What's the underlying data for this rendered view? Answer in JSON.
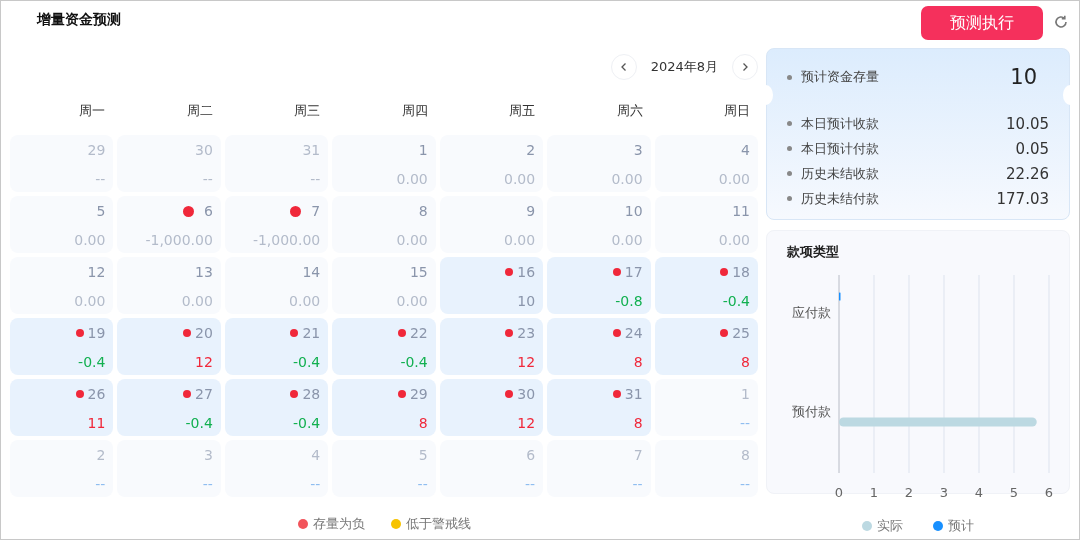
{
  "title": "增量资金预测",
  "execute_button": "预测执行",
  "calendar": {
    "month": "2024年8月",
    "weekdays": [
      "周一",
      "周二",
      "周三",
      "周四",
      "周五",
      "周六",
      "周日"
    ],
    "weeks": [
      [
        {
          "day": "29",
          "value": "--",
          "in_month": false,
          "forecast": false,
          "flagged": false,
          "color": "#b3bbca"
        },
        {
          "day": "30",
          "value": "--",
          "in_month": false,
          "forecast": false,
          "flagged": false,
          "color": "#b3bbca"
        },
        {
          "day": "31",
          "value": "--",
          "in_month": false,
          "forecast": false,
          "flagged": false,
          "color": "#b3bbca"
        },
        {
          "day": "1",
          "value": "0.00",
          "in_month": true,
          "forecast": false,
          "flagged": false,
          "color": "#b3bbca"
        },
        {
          "day": "2",
          "value": "0.00",
          "in_month": true,
          "forecast": false,
          "flagged": false,
          "color": "#b3bbca"
        },
        {
          "day": "3",
          "value": "0.00",
          "in_month": true,
          "forecast": false,
          "flagged": false,
          "color": "#b3bbca"
        },
        {
          "day": "4",
          "value": "0.00",
          "in_month": true,
          "forecast": false,
          "flagged": false,
          "color": "#b3bbca"
        }
      ],
      [
        {
          "day": "5",
          "value": "0.00",
          "in_month": true,
          "forecast": false,
          "flagged": false,
          "color": "#b3bbca"
        },
        {
          "day": "6",
          "value": "-1,000.00",
          "in_month": true,
          "forecast": false,
          "flagged": true,
          "color": "#b3bbca"
        },
        {
          "day": "7",
          "value": "-1,000.00",
          "in_month": true,
          "forecast": false,
          "flagged": true,
          "color": "#b3bbca"
        },
        {
          "day": "8",
          "value": "0.00",
          "in_month": true,
          "forecast": false,
          "flagged": false,
          "color": "#b3bbca"
        },
        {
          "day": "9",
          "value": "0.00",
          "in_month": true,
          "forecast": false,
          "flagged": false,
          "color": "#b3bbca"
        },
        {
          "day": "10",
          "value": "0.00",
          "in_month": true,
          "forecast": false,
          "flagged": false,
          "color": "#b3bbca"
        },
        {
          "day": "11",
          "value": "0.00",
          "in_month": true,
          "forecast": false,
          "flagged": false,
          "color": "#b3bbca"
        }
      ],
      [
        {
          "day": "12",
          "value": "0.00",
          "in_month": true,
          "forecast": false,
          "flagged": false,
          "color": "#b3bbca"
        },
        {
          "day": "13",
          "value": "0.00",
          "in_month": true,
          "forecast": false,
          "flagged": false,
          "color": "#b3bbca"
        },
        {
          "day": "14",
          "value": "0.00",
          "in_month": true,
          "forecast": false,
          "flagged": false,
          "color": "#b3bbca"
        },
        {
          "day": "15",
          "value": "0.00",
          "in_month": true,
          "forecast": false,
          "flagged": false,
          "color": "#b3bbca"
        },
        {
          "day": "16",
          "value": "10",
          "in_month": true,
          "forecast": true,
          "flagged": true,
          "color": "#8a95ab"
        },
        {
          "day": "17",
          "value": "-0.8",
          "in_month": true,
          "forecast": true,
          "flagged": true,
          "color": "#12b050"
        },
        {
          "day": "18",
          "value": "-0.4",
          "in_month": true,
          "forecast": true,
          "flagged": true,
          "color": "#12b050"
        }
      ],
      [
        {
          "day": "19",
          "value": "-0.4",
          "in_month": true,
          "forecast": true,
          "flagged": true,
          "color": "#12b050"
        },
        {
          "day": "20",
          "value": "12",
          "in_month": true,
          "forecast": true,
          "flagged": true,
          "color": "#f0283a"
        },
        {
          "day": "21",
          "value": "-0.4",
          "in_month": true,
          "forecast": true,
          "flagged": true,
          "color": "#12b050"
        },
        {
          "day": "22",
          "value": "-0.4",
          "in_month": true,
          "forecast": true,
          "flagged": true,
          "color": "#12b050"
        },
        {
          "day": "23",
          "value": "12",
          "in_month": true,
          "forecast": true,
          "flagged": true,
          "color": "#f0283a"
        },
        {
          "day": "24",
          "value": "8",
          "in_month": true,
          "forecast": true,
          "flagged": true,
          "color": "#f0283a"
        },
        {
          "day": "25",
          "value": "8",
          "in_month": true,
          "forecast": true,
          "flagged": true,
          "color": "#f0283a"
        }
      ],
      [
        {
          "day": "26",
          "value": "11",
          "in_month": true,
          "forecast": true,
          "flagged": true,
          "color": "#f0283a"
        },
        {
          "day": "27",
          "value": "-0.4",
          "in_month": true,
          "forecast": true,
          "flagged": true,
          "color": "#12b050"
        },
        {
          "day": "28",
          "value": "-0.4",
          "in_month": true,
          "forecast": true,
          "flagged": true,
          "color": "#12b050"
        },
        {
          "day": "29",
          "value": "8",
          "in_month": true,
          "forecast": true,
          "flagged": true,
          "color": "#f0283a"
        },
        {
          "day": "30",
          "value": "12",
          "in_month": true,
          "forecast": true,
          "flagged": true,
          "color": "#f0283a"
        },
        {
          "day": "31",
          "value": "8",
          "in_month": true,
          "forecast": true,
          "flagged": true,
          "color": "#f0283a"
        },
        {
          "day": "1",
          "value": "--",
          "in_month": false,
          "forecast": false,
          "flagged": false,
          "color": "#8fbdf0"
        }
      ],
      [
        {
          "day": "2",
          "value": "--",
          "in_month": false,
          "forecast": false,
          "flagged": false,
          "color": "#8fbdf0"
        },
        {
          "day": "3",
          "value": "--",
          "in_month": false,
          "forecast": false,
          "flagged": false,
          "color": "#8fbdf0"
        },
        {
          "day": "4",
          "value": "--",
          "in_month": false,
          "forecast": false,
          "flagged": false,
          "color": "#8fbdf0"
        },
        {
          "day": "5",
          "value": "--",
          "in_month": false,
          "forecast": false,
          "flagged": false,
          "color": "#8fbdf0"
        },
        {
          "day": "6",
          "value": "--",
          "in_month": false,
          "forecast": false,
          "flagged": false,
          "color": "#8fbdf0"
        },
        {
          "day": "7",
          "value": "--",
          "in_month": false,
          "forecast": false,
          "flagged": false,
          "color": "#8fbdf0"
        },
        {
          "day": "8",
          "value": "--",
          "in_month": false,
          "forecast": false,
          "flagged": false,
          "color": "#8fbdf0"
        }
      ]
    ],
    "legend": [
      {
        "label": "存量为负",
        "color": "#f2545b"
      },
      {
        "label": "低于警戒线",
        "color": "#f7c300"
      }
    ]
  },
  "summary": {
    "headline": {
      "label": "预计资金存量",
      "value": "10"
    },
    "items": [
      {
        "label": "本日预计收款",
        "value": "10.05"
      },
      {
        "label": "本日预计付款",
        "value": "0.05"
      },
      {
        "label": "历史未结收款",
        "value": "22.26"
      },
      {
        "label": "历史未结付款",
        "value": "177.03"
      }
    ]
  },
  "payment_types": {
    "title": "款项类型",
    "chart_data": {
      "type": "bar",
      "orientation": "horizontal",
      "grid": true,
      "categories": [
        "应付款",
        "预付款"
      ],
      "series": [
        {
          "name": "实际",
          "color": "#bcd9e2",
          "values": [
            0,
            5.65
          ]
        },
        {
          "name": "预计",
          "color": "#1890ff",
          "values": [
            0.02,
            0
          ]
        }
      ],
      "xlim": [
        0,
        6
      ],
      "xticks": [
        0,
        1,
        2,
        3,
        4,
        5,
        6
      ]
    }
  }
}
